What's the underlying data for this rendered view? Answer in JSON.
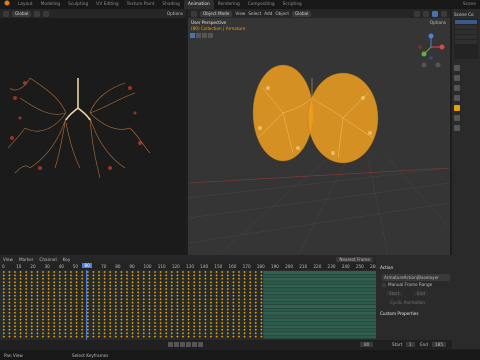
{
  "topbar": {
    "tabs": [
      "Layout",
      "Modeling",
      "Sculpting",
      "UV Editing",
      "Texture Paint",
      "Shading",
      "Animation",
      "Rendering",
      "Compositing",
      "Scripting"
    ],
    "active": "Animation",
    "scene": "Scene"
  },
  "left_viewport": {
    "orientation": "Global",
    "options": "Options"
  },
  "right_viewport": {
    "mode": "Object Mode",
    "menus": [
      "View",
      "Select",
      "Add",
      "Object"
    ],
    "orientation": "Global",
    "overlay_title": "User Perspective",
    "overlay_subtitle": "(80) Collection | Armature",
    "options": "Options"
  },
  "outliner": {
    "title": "Scene Co"
  },
  "timeline": {
    "menus": [
      "View",
      "Marker",
      "Channel",
      "Key"
    ],
    "frame_labels": [
      "0",
      "10",
      "20",
      "30",
      "40",
      "50",
      "60",
      "70",
      "80",
      "90",
      "100",
      "110",
      "120",
      "130",
      "140",
      "150",
      "160",
      "170",
      "180",
      "190",
      "200",
      "210",
      "220",
      "230",
      "240",
      "250",
      "260"
    ],
    "current_frame": "80",
    "row_count": 20,
    "key_end_fraction": 0.7,
    "current_frame_fraction": 0.23,
    "nearest_frame": "Nearest Frame"
  },
  "action_panel": {
    "header": "Action",
    "action_name": "ArmatureAction|Baselayer",
    "manual_frame_range": "Manual Frame Range",
    "start_label": "Start",
    "end_label": "End",
    "cyclic": "Cyclic Animation",
    "custom_props": "Custom Properties"
  },
  "playback": {
    "current": "80",
    "start_label": "Start",
    "start": "1",
    "end_label": "End",
    "end": "185"
  },
  "status": {
    "left": "Pan View",
    "right": "Select Keyframes"
  },
  "colors": {
    "active_blue": "#4772b3",
    "key_orange": "#e8a200",
    "playhead": "#4d7fd6",
    "lung_left": "#c77a3a",
    "lung_right": "#f0a020"
  }
}
